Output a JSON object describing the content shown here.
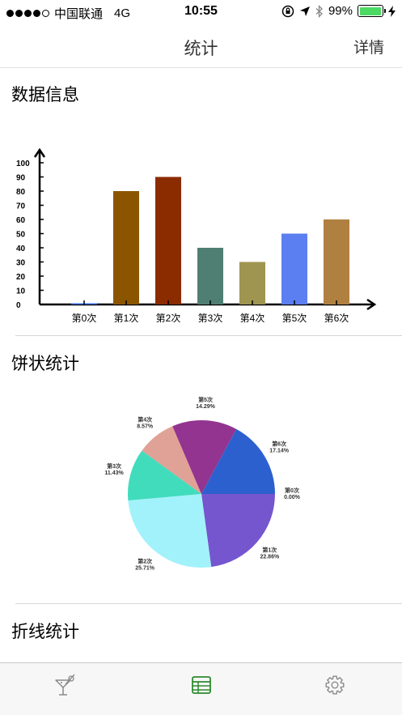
{
  "status_bar": {
    "carrier": "中国联通",
    "network": "4G",
    "time": "10:55",
    "battery": "99%",
    "battery_level": 0.99
  },
  "nav": {
    "title": "统计",
    "detail_label": "详情"
  },
  "sections": {
    "bar_title": "数据信息",
    "pie_title": "饼状统计",
    "line_title": "折线统计"
  },
  "chart_data": [
    {
      "type": "bar",
      "categories": [
        "第0次",
        "第1次",
        "第2次",
        "第3次",
        "第4次",
        "第5次",
        "第6次"
      ],
      "values": [
        0,
        80,
        90,
        40,
        30,
        50,
        60
      ],
      "colors": [
        "#3b6ff5",
        "#8b5500",
        "#8b2c00",
        "#4f7f72",
        "#9f9550",
        "#5b7ef0",
        "#b08040"
      ],
      "y_ticks": [
        0,
        10,
        20,
        30,
        40,
        50,
        60,
        70,
        80,
        90,
        100
      ],
      "ylim": [
        0,
        100
      ]
    },
    {
      "type": "pie",
      "categories": [
        "第0次",
        "第1次",
        "第2次",
        "第3次",
        "第4次",
        "第5次",
        "第6次"
      ],
      "percent_labels": [
        "0.00%",
        "22.86%",
        "25.71%",
        "11.43%",
        "8.57%",
        "14.29%",
        "17.14%"
      ],
      "values": [
        0,
        22.86,
        25.71,
        11.43,
        8.57,
        14.29,
        17.14
      ],
      "colors": [
        "#e74c3c",
        "#7556cf",
        "#a2f2fb",
        "#41dcbc",
        "#e0a196",
        "#933490",
        "#2c60ce"
      ]
    }
  ],
  "tab_bar": {
    "items": [
      {
        "icon": "cocktail-icon",
        "selected": false
      },
      {
        "icon": "table-icon",
        "selected": true,
        "color": "#2e8b2e"
      },
      {
        "icon": "gear-icon",
        "selected": false
      }
    ]
  }
}
